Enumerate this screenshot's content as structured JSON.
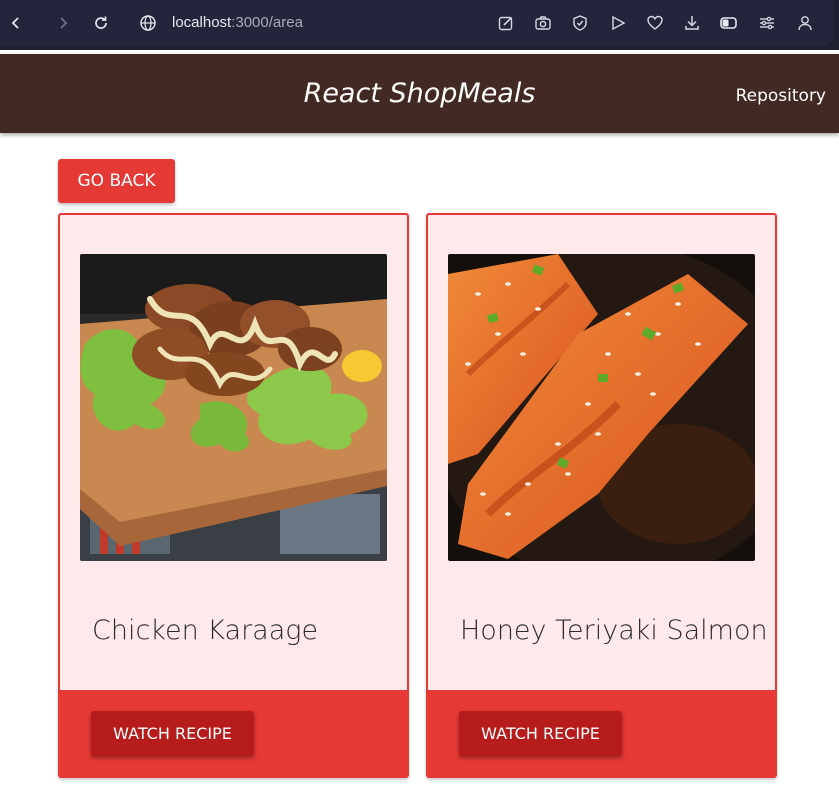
{
  "browser": {
    "url_host": "localhost",
    "url_path": ":3000/area"
  },
  "header": {
    "title": "React ShopMeals",
    "repo_link": "Repository"
  },
  "page": {
    "go_back_label": "GO BACK"
  },
  "meals": [
    {
      "name": "Chicken Karaage",
      "button_label": "WATCH RECIPE"
    },
    {
      "name": "Honey Teriyaki Salmon",
      "button_label": "WATCH RECIPE"
    }
  ],
  "colors": {
    "header_bg": "#432924",
    "accent": "#e53935",
    "accent_dark": "#b71c1c",
    "card_bg": "#ffe9ea"
  }
}
